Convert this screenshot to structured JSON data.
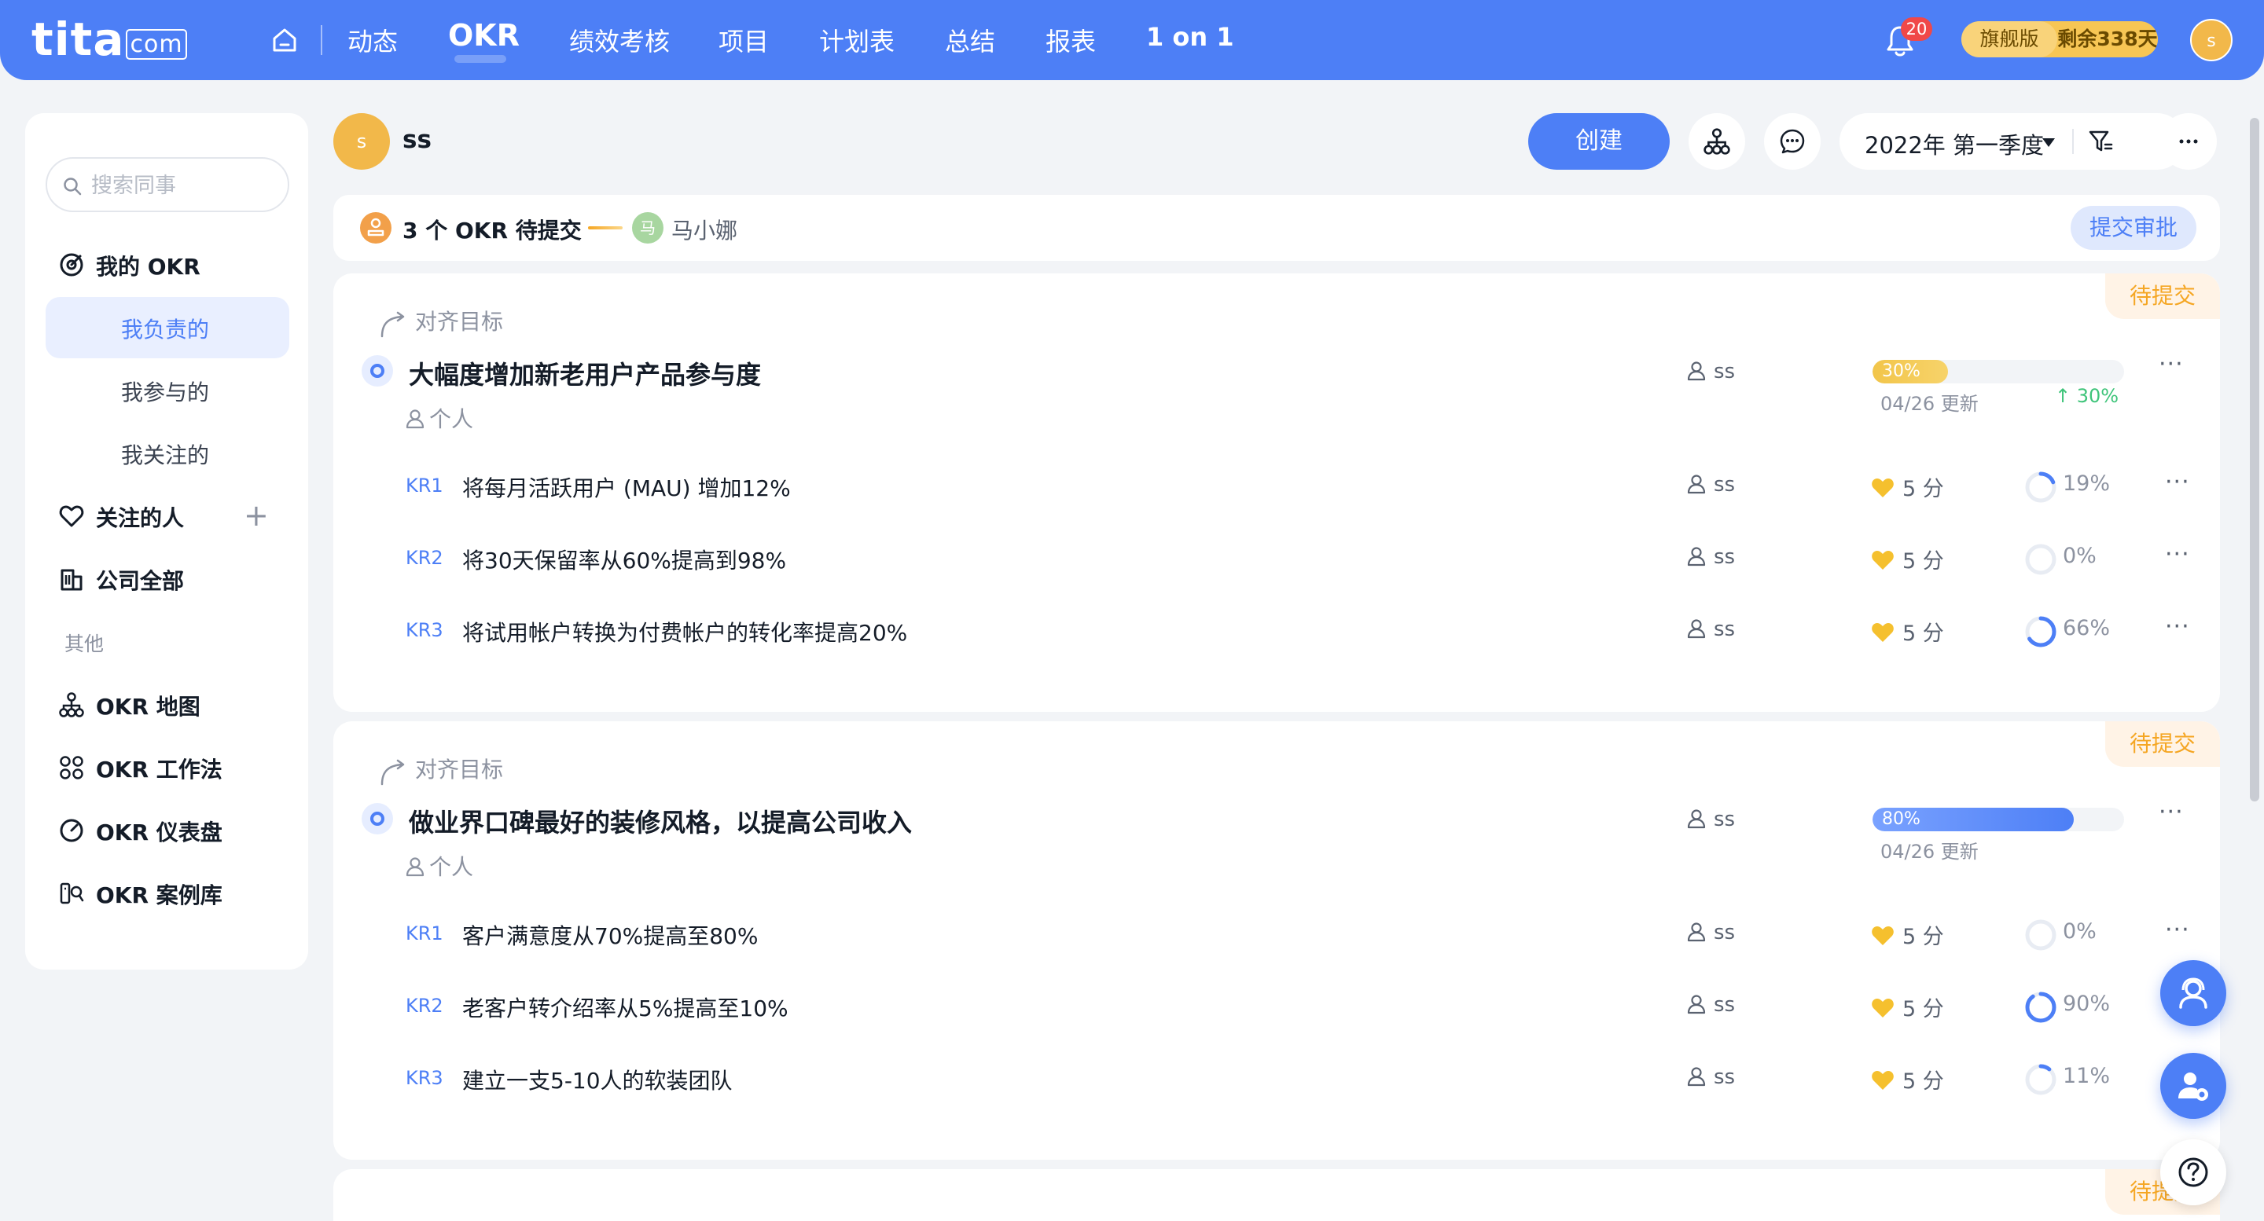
{
  "topnav": {
    "logo_main": "tita",
    "logo_com": "com",
    "items": [
      "动态",
      "OKR",
      "绩效考核",
      "项目",
      "计划表",
      "总结",
      "报表",
      "1 on 1"
    ],
    "notification_count": "20",
    "edition_name": "旗舰版",
    "edition_remaining": "剩余338天",
    "avatar_initial": "s",
    "accent_color": "#4d7ff6"
  },
  "sidebar": {
    "search_placeholder": "搜索同事",
    "my_okr": "我的 OKR",
    "sub_items": [
      "我负责的",
      "我参与的",
      "我关注的"
    ],
    "followed": "关注的人",
    "company_all": "公司全部",
    "others_group": "其他",
    "tools": [
      "OKR 地图",
      "OKR 工作法",
      "OKR 仪表盘",
      "OKR 案例库"
    ]
  },
  "header": {
    "avatar_initial": "s",
    "user_name": "ss",
    "create_label": "创建",
    "period": "2022年 第一季度"
  },
  "pending": {
    "text": "3 个 OKR 待提交",
    "approver_initial": "马",
    "approver_name": "马小娜",
    "submit_label": "提交审批"
  },
  "okrs": [
    {
      "status": "待提交",
      "align_label": "对齐目标",
      "title": "大幅度增加新老用户产品参与度",
      "type": "个人",
      "owner": "ss",
      "progress": 30,
      "progress_label": "30%",
      "updated": "04/26 更新",
      "delta": "↑ 30%",
      "bar_color": "#f2c54a",
      "krs": [
        {
          "tag": "KR1",
          "title": "将每月活跃用户 (MAU) 增加12%",
          "owner": "ss",
          "score": "5 分",
          "percent": "19%",
          "value": 19
        },
        {
          "tag": "KR2",
          "title": "将30天保留率从60%提高到98%",
          "owner": "ss",
          "score": "5 分",
          "percent": "0%",
          "value": 0
        },
        {
          "tag": "KR3",
          "title": "将试用帐户转换为付费帐户的转化率提高20%",
          "owner": "ss",
          "score": "5 分",
          "percent": "66%",
          "value": 66
        }
      ]
    },
    {
      "status": "待提交",
      "align_label": "对齐目标",
      "title": "做业界口碑最好的装修风格，以提高公司收入",
      "type": "个人",
      "owner": "ss",
      "progress": 80,
      "progress_label": "80%",
      "updated": "04/26 更新",
      "bar_color": "#4d7ff6",
      "krs": [
        {
          "tag": "KR1",
          "title": "客户满意度从70%提高至80%",
          "owner": "ss",
          "score": "5 分",
          "percent": "0%",
          "value": 0
        },
        {
          "tag": "KR2",
          "title": "老客户转介绍率从5%提高至10%",
          "owner": "ss",
          "score": "5 分",
          "percent": "90%",
          "value": 90
        },
        {
          "tag": "KR3",
          "title": "建立一支5-10人的软装团队",
          "owner": "ss",
          "score": "5 分",
          "percent": "11%",
          "value": 11
        }
      ]
    },
    {
      "status": "待提交"
    }
  ],
  "icons": {
    "home": "home-icon",
    "bell": "bell-icon",
    "search": "search-icon",
    "org_chart": "org-chart-icon",
    "comment": "comment-icon",
    "filter": "filter-icon",
    "more": "more-icon",
    "heart": "heart-icon",
    "score": "heart-score-icon",
    "user": "user-icon",
    "support": "support-icon",
    "help": "help-icon"
  }
}
